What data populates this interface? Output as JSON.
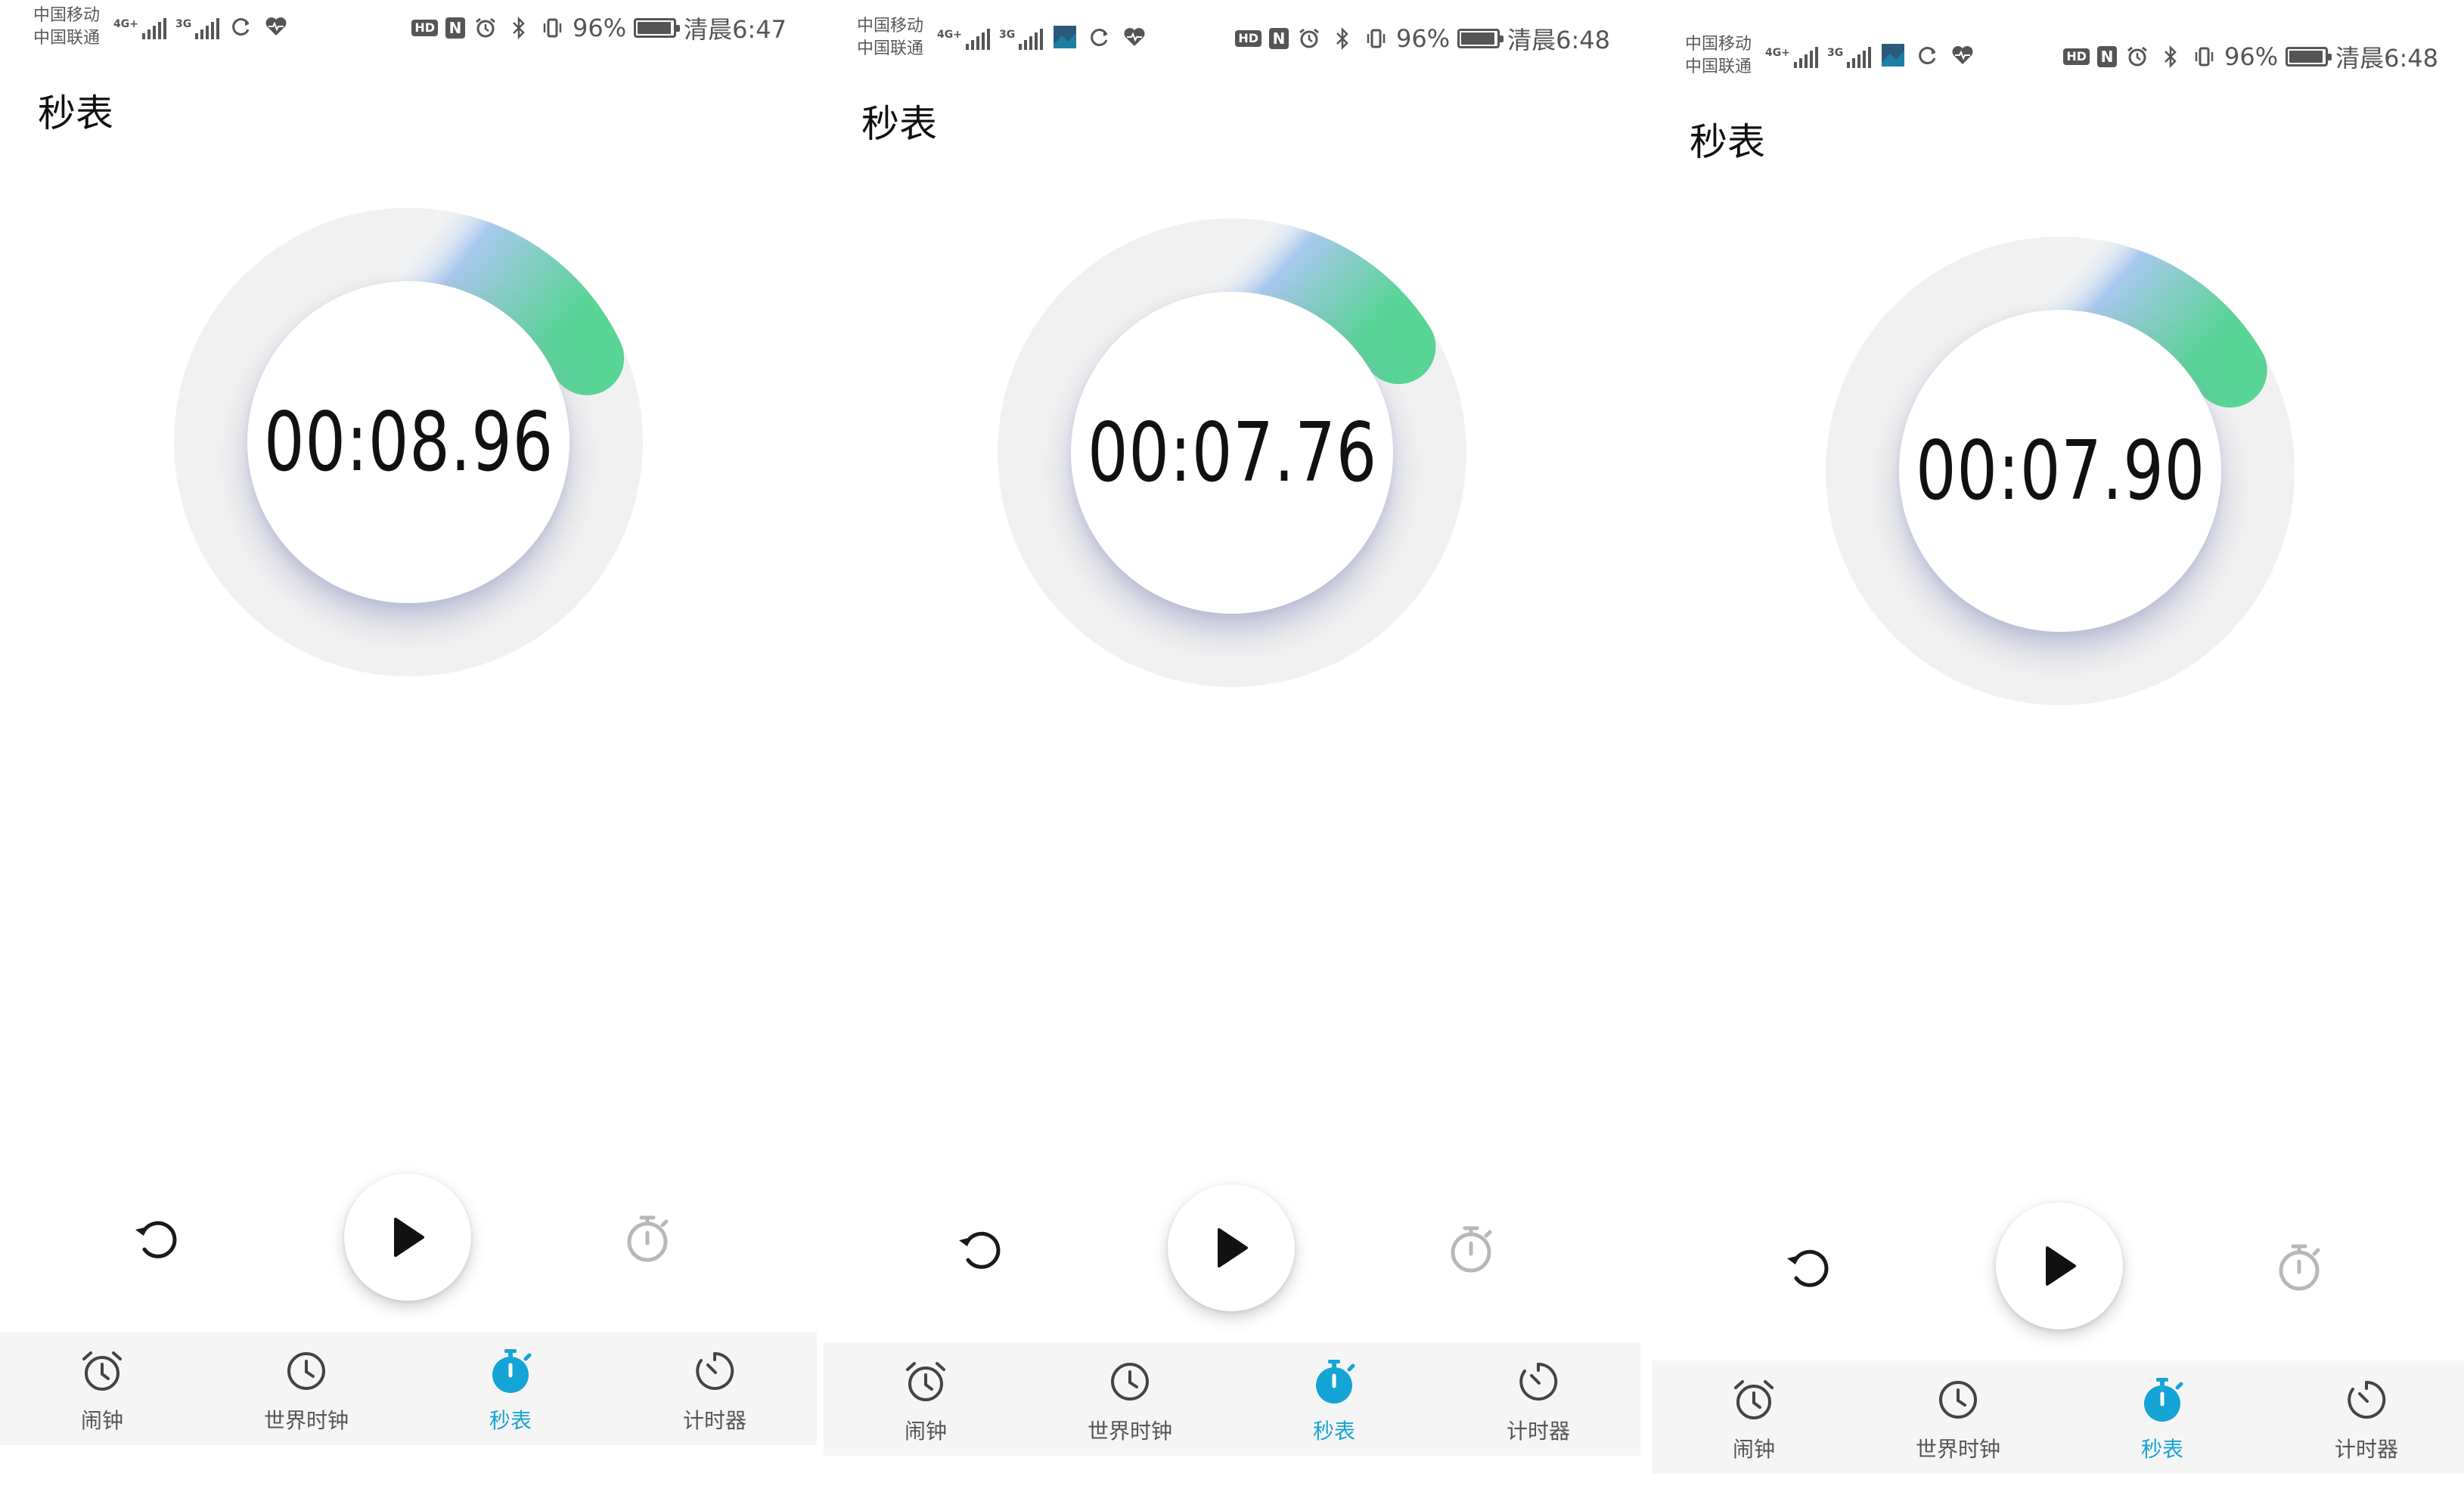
{
  "colors": {
    "accent": "#15a4d6",
    "ring_track": "#f1f1f1",
    "ring_gradient_start": "#a8c8ec",
    "ring_gradient_end": "#58d495",
    "nav_background": "#f5f5f5"
  },
  "screens": [
    {
      "status": {
        "carrier_1": "中国移动",
        "carrier_2": "中国联通",
        "sig1_tag": "4G+",
        "sig2_tag": "3G",
        "battery": "96%",
        "battery_level": 0.96,
        "time": "清晨6:47",
        "hd": "HD",
        "nfc": "N"
      },
      "title": "秒表",
      "elapsed": "00:08.96",
      "ring_fraction": 0.18,
      "controls": {
        "reset_icon": "reset-icon",
        "play_icon": "play-icon",
        "lap_icon": "lap-stopwatch-icon"
      },
      "nav": {
        "alarm": "闹钟",
        "world_clock": "世界时钟",
        "stopwatch": "秒表",
        "timer": "计时器"
      }
    },
    {
      "status": {
        "carrier_1": "中国移动",
        "carrier_2": "中国联通",
        "sig1_tag": "4G+",
        "sig2_tag": "3G",
        "battery": "96%",
        "battery_level": 0.96,
        "time": "清晨6:48",
        "hd": "HD",
        "nfc": "N"
      },
      "title": "秒表",
      "elapsed": "00:07.76",
      "ring_fraction": 0.16,
      "controls": {
        "reset_icon": "reset-icon",
        "play_icon": "play-icon",
        "lap_icon": "lap-stopwatch-icon"
      },
      "nav": {
        "alarm": "闹钟",
        "world_clock": "世界时钟",
        "stopwatch": "秒表",
        "timer": "计时器"
      }
    },
    {
      "status": {
        "carrier_1": "中国移动",
        "carrier_2": "中国联通",
        "sig1_tag": "4G+",
        "sig2_tag": "3G",
        "battery": "96%",
        "battery_level": 0.96,
        "time": "清晨6:48",
        "hd": "HD",
        "nfc": "N"
      },
      "title": "秒表",
      "elapsed": "00:07.90",
      "ring_fraction": 0.165,
      "controls": {
        "reset_icon": "reset-icon",
        "play_icon": "play-icon",
        "lap_icon": "lap-stopwatch-icon"
      },
      "nav": {
        "alarm": "闹钟",
        "world_clock": "世界时钟",
        "stopwatch": "秒表",
        "timer": "计时器"
      }
    }
  ]
}
